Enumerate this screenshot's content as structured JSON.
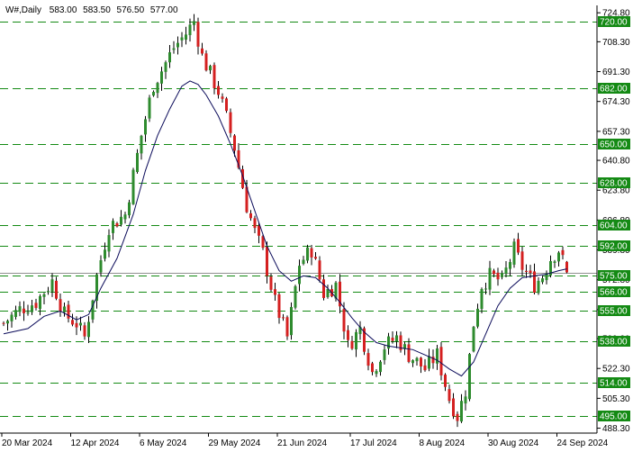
{
  "chart_data": {
    "type": "candlestick",
    "symbol": "W#,Daily",
    "ohlc_readout": {
      "open": "583.00",
      "high": "583.50",
      "low": "576.50",
      "close": "577.00"
    },
    "current_price": 577.0,
    "ylim": [
      485.5,
      729.0
    ],
    "y_ticks": [
      "724.80",
      "708.30",
      "691.30",
      "674.30",
      "657.30",
      "640.80",
      "623.80",
      "606.80",
      "589.80",
      "572.80",
      "555.80",
      "539.30",
      "522.30",
      "505.30",
      "488.30"
    ],
    "x_tick_labels": [
      {
        "label": "20 Mar 2024",
        "index": 0
      },
      {
        "label": "12 Apr 2024",
        "index": 17
      },
      {
        "label": "6 May 2024",
        "index": 34
      },
      {
        "label": "29 May 2024",
        "index": 51
      },
      {
        "label": "21 Jun 2024",
        "index": 68
      },
      {
        "label": "17 Jul 2024",
        "index": 86
      },
      {
        "label": "8 Aug 2024",
        "index": 103
      },
      {
        "label": "30 Aug 2024",
        "index": 120
      },
      {
        "label": "24 Sep 2024",
        "index": 137
      }
    ],
    "levels": [
      {
        "price": 720.0,
        "label": "720.00"
      },
      {
        "price": 682.0,
        "label": "682.00"
      },
      {
        "price": 650.0,
        "label": "650.00"
      },
      {
        "price": 628.0,
        "label": "628.00"
      },
      {
        "price": 604.0,
        "label": "604.00"
      },
      {
        "price": 592.0,
        "label": "592.00"
      },
      {
        "price": 575.0,
        "label": "575.00"
      },
      {
        "price": 566.0,
        "label": "566.00"
      },
      {
        "price": 555.0,
        "label": "555.00"
      },
      {
        "price": 538.0,
        "label": "538.00"
      },
      {
        "price": 514.0,
        "label": "514.00"
      },
      {
        "price": 495.0,
        "label": "495.00"
      }
    ],
    "close_path": [
      [
        0,
        548
      ],
      [
        4,
        556
      ],
      [
        8,
        560
      ],
      [
        12,
        572
      ],
      [
        15,
        553
      ],
      [
        18,
        548
      ],
      [
        20,
        540
      ],
      [
        23,
        575
      ],
      [
        26,
        603
      ],
      [
        30,
        610
      ],
      [
        34,
        655
      ],
      [
        37,
        684
      ],
      [
        39,
        692
      ],
      [
        42,
        705
      ],
      [
        45,
        713
      ],
      [
        47,
        720
      ],
      [
        49,
        700
      ],
      [
        51,
        690
      ],
      [
        53,
        680
      ],
      [
        55,
        665
      ],
      [
        57,
        648
      ],
      [
        60,
        615
      ],
      [
        62,
        600
      ],
      [
        64,
        588
      ],
      [
        67,
        560
      ],
      [
        70,
        540
      ],
      [
        73,
        582
      ],
      [
        76,
        590
      ],
      [
        79,
        565
      ],
      [
        82,
        570
      ],
      [
        85,
        535
      ],
      [
        88,
        545
      ],
      [
        91,
        520
      ],
      [
        94,
        535
      ],
      [
        97,
        540
      ],
      [
        100,
        530
      ],
      [
        104,
        522
      ],
      [
        107,
        530
      ],
      [
        110,
        505
      ],
      [
        112,
        495
      ],
      [
        114,
        510
      ],
      [
        116,
        548
      ],
      [
        118,
        570
      ],
      [
        120,
        575
      ],
      [
        123,
        572
      ],
      [
        126,
        590
      ],
      [
        128,
        580
      ],
      [
        131,
        570
      ],
      [
        133,
        575
      ],
      [
        135,
        585
      ],
      [
        137,
        590
      ],
      [
        139,
        577
      ]
    ],
    "ma_path": [
      [
        0,
        542
      ],
      [
        6,
        545
      ],
      [
        10,
        552
      ],
      [
        14,
        555
      ],
      [
        18,
        550
      ],
      [
        21,
        553
      ],
      [
        24,
        568
      ],
      [
        28,
        585
      ],
      [
        32,
        610
      ],
      [
        35,
        635
      ],
      [
        38,
        655
      ],
      [
        41,
        670
      ],
      [
        44,
        683
      ],
      [
        46,
        686
      ],
      [
        48,
        684
      ],
      [
        50,
        678
      ],
      [
        53,
        666
      ],
      [
        56,
        650
      ],
      [
        59,
        632
      ],
      [
        62,
        612
      ],
      [
        65,
        592
      ],
      [
        68,
        578
      ],
      [
        71,
        572
      ],
      [
        74,
        575
      ],
      [
        77,
        574
      ],
      [
        80,
        568
      ],
      [
        83,
        560
      ],
      [
        86,
        551
      ],
      [
        89,
        543
      ],
      [
        92,
        537
      ],
      [
        95,
        535
      ],
      [
        98,
        534
      ],
      [
        101,
        533
      ],
      [
        104,
        530
      ],
      [
        107,
        527
      ],
      [
        110,
        522
      ],
      [
        113,
        518
      ],
      [
        116,
        526
      ],
      [
        119,
        542
      ],
      [
        122,
        558
      ],
      [
        125,
        568
      ],
      [
        128,
        574
      ],
      [
        131,
        575
      ],
      [
        134,
        576
      ],
      [
        137,
        578
      ],
      [
        139,
        579
      ]
    ],
    "seed": 7,
    "bull_color": "#2e8b2e",
    "bear_color": "#d42020",
    "wick_color": "#000000",
    "ma_color": "#0b0b5a",
    "level_color": "#148a14",
    "price_line_color": "#909090"
  }
}
